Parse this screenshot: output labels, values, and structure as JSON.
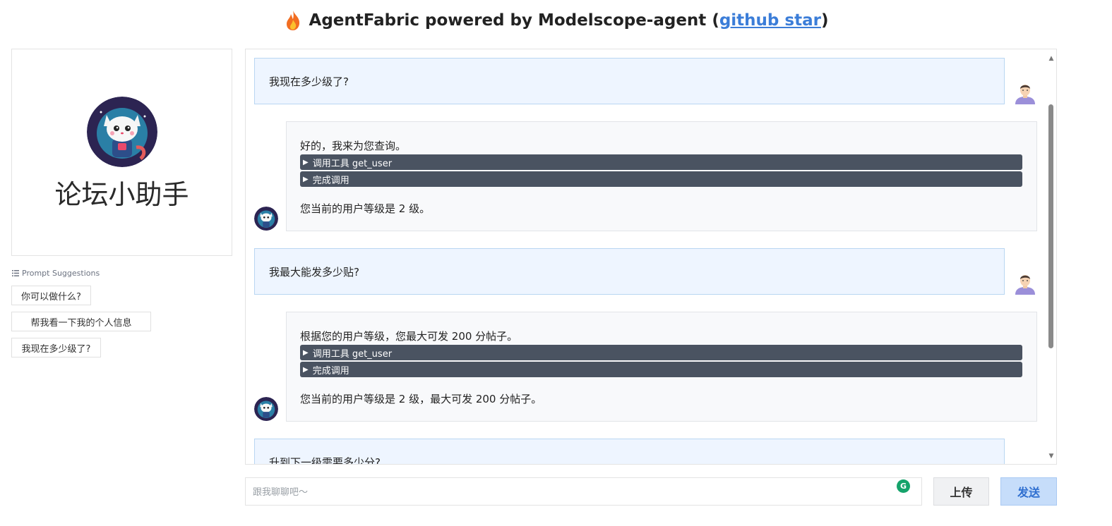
{
  "header": {
    "title": "AgentFabric powered by Modelscope-agent (",
    "link": "github star",
    "close": ")"
  },
  "agent": {
    "name": "论坛小助手"
  },
  "suggestions": {
    "label": "Prompt Suggestions",
    "items": [
      "你可以做什么?",
      "帮我看一下我的个人信息",
      "我现在多少级了?"
    ]
  },
  "chat": {
    "messages": [
      {
        "role": "user",
        "text": "我现在多少级了?"
      },
      {
        "role": "bot",
        "intro": "好的，我来为您查询。",
        "tool_call": "调用工具 get_user",
        "tool_done": "完成调用",
        "answer": "您当前的用户等级是 2 级。"
      },
      {
        "role": "user",
        "text": "我最大能发多少贴?"
      },
      {
        "role": "bot",
        "intro": "根据您的用户等级，您最大可发 200 分帖子。",
        "tool_call": "调用工具 get_user",
        "tool_done": "完成调用",
        "answer": "您当前的用户等级是 2 级，最大可发 200 分帖子。"
      },
      {
        "role": "user",
        "text": "升到下一级需要多少分?"
      }
    ]
  },
  "input": {
    "placeholder": "跟我聊聊吧～"
  },
  "buttons": {
    "upload": "上传",
    "send": "发送"
  },
  "icons": {
    "title_icon": "flame-icon",
    "user_avatar": "user-avatar-icon",
    "bot_avatar": "cat-robot-avatar",
    "list_icon": "list-icon",
    "grammarly": "grammarly-icon"
  },
  "colors": {
    "user_bubble": "#eef5ff",
    "tool_bar": "#4a5361",
    "send_button": "#c6ddfa",
    "link": "#3b7dd8"
  }
}
